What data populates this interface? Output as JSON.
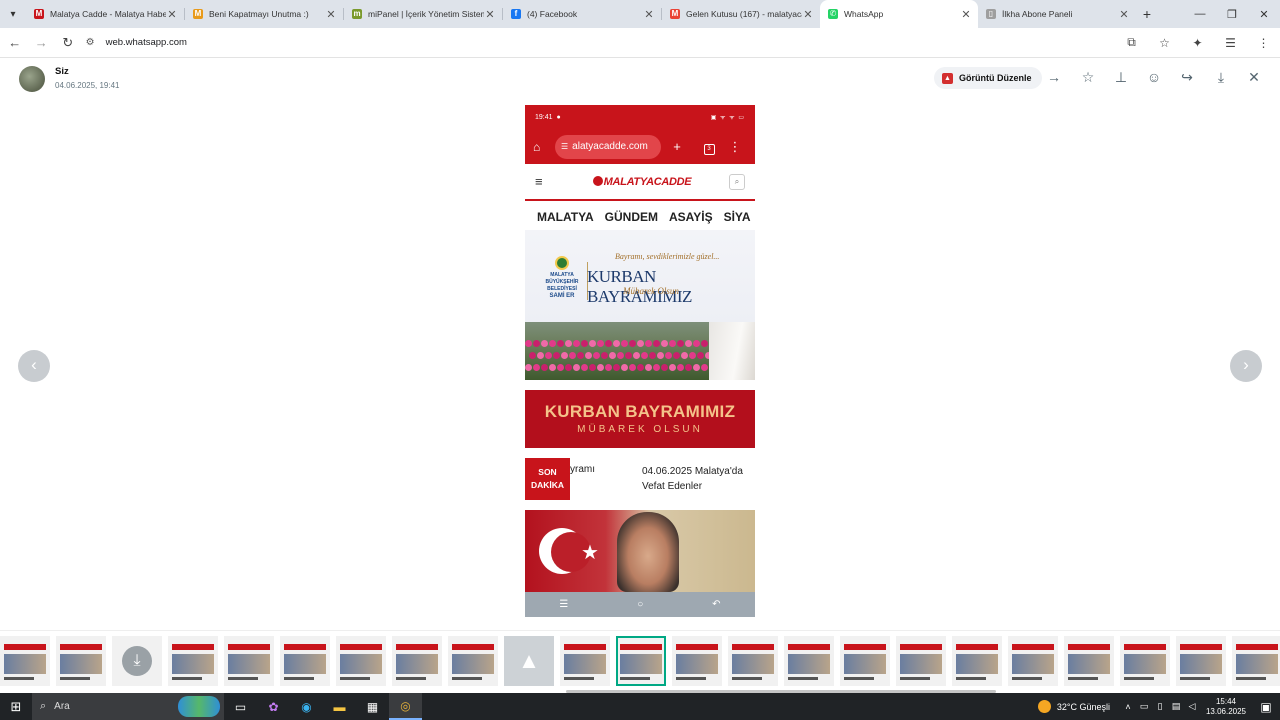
{
  "browser": {
    "tabs": [
      {
        "title": "Malatya Cadde - Malatya Habe",
        "fav_color": "#c8141b",
        "fav_glyph": "M"
      },
      {
        "title": "Beni Kapatmayı Unutma :)",
        "fav_color": "#e89a1b",
        "fav_glyph": "M"
      },
      {
        "title": "miPanel | İçerik Yönetim Sistemi",
        "fav_color": "#7a9a2c",
        "fav_glyph": "m"
      },
      {
        "title": "(4) Facebook",
        "fav_color": "#1877f2",
        "fav_glyph": "f"
      },
      {
        "title": "Gelen Kutusu (167) - malatyaca",
        "fav_color": "#ea4335",
        "fav_glyph": "M"
      },
      {
        "title": "WhatsApp",
        "fav_color": "#25d366",
        "fav_glyph": "✆",
        "active": true
      },
      {
        "title": "İlkha Abone Paneli",
        "fav_color": "#9e9e9e",
        "fav_glyph": "▯"
      }
    ],
    "url": "web.whatsapp.com"
  },
  "viewer": {
    "sender": "Siz",
    "timestamp": "04.06.2025, 19:41",
    "edit_label": "Görüntü Düzenle",
    "edit_icon": "pdf-icon",
    "header_icons": [
      "arrow-right-icon",
      "star-icon",
      "pin-icon",
      "emoji-icon",
      "forward-icon",
      "download-icon",
      "close-icon"
    ]
  },
  "phone": {
    "time": "19:41",
    "status_icons": "▣ ᯤ ᯤ ▭",
    "url_text": "alatyacadde.com",
    "tab_count": "3",
    "logo_text": "MALATYACADDE",
    "menu": [
      "MALATYA",
      "GÜNDEM",
      "ASAYİŞ",
      "SİYA"
    ],
    "banner1": {
      "subtitle": "Bayramı, sevdiklerimizle güzel...",
      "title": "KURBAN BAYRAMIMIZ",
      "wish": "Mübarek Olsun",
      "municipality": "MALATYA BÜYÜKŞEHİR BELEDİYESİ",
      "mayor": "SAMİ ER"
    },
    "banner2": {
      "title": "KURBAN BAYRAMIMIZ",
      "subtitle": "MÜBAREK OLSUN"
    },
    "ticker": {
      "badge_line1": "SON",
      "badge_line2": "DAKİKA",
      "item1": "yramı",
      "item2_line1": "04.06.2025 Malatya'da",
      "item2_line2": "Vefat Edenler"
    }
  },
  "thumbnails": {
    "count": 23,
    "selected_index": 11
  },
  "taskbar": {
    "search_label": "Ara",
    "weather": "32°C Güneşli",
    "time": "15:44",
    "date": "13.06.2025"
  },
  "colors": {
    "accent": "#c8141b",
    "whatsapp": "#00a884"
  }
}
